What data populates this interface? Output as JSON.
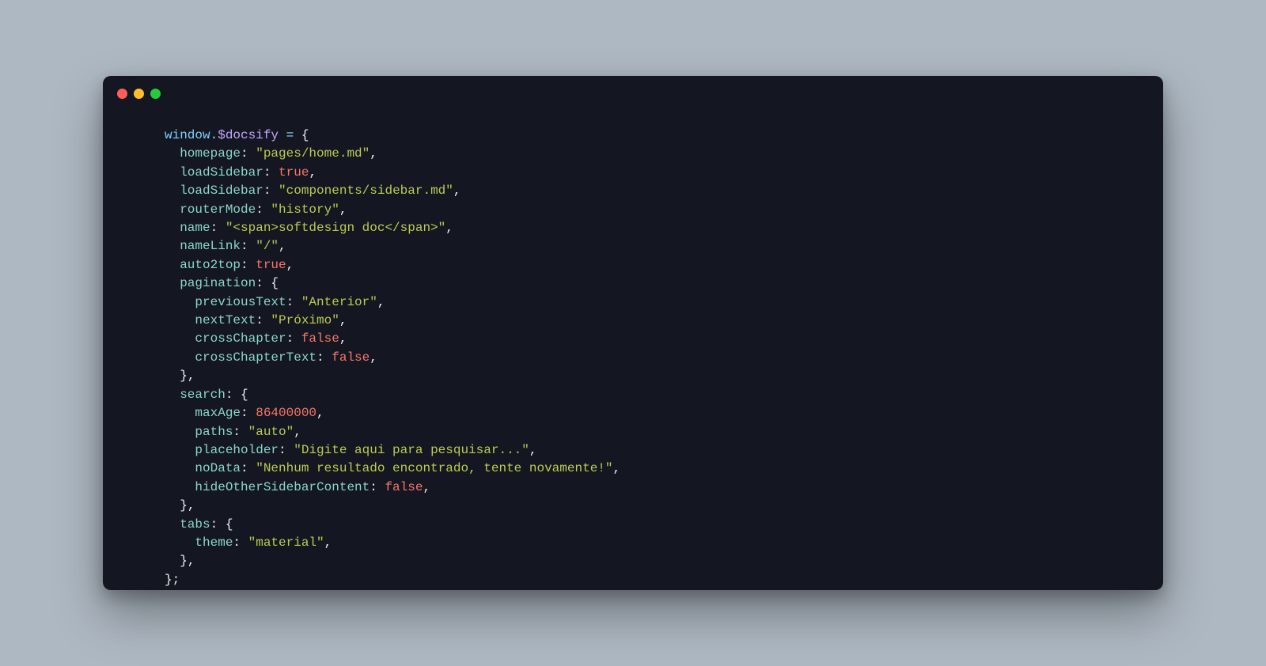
{
  "code": {
    "obj": "window",
    "dot": ".",
    "var": "$docsify",
    "eq": " = ",
    "open": "{",
    "close": "};",
    "braceClose": "}",
    "comma": ",",
    "colon": ": ",
    "colonTight": ":",
    "keys": {
      "homepage": "homepage",
      "loadSidebar": "loadSidebar",
      "routerMode": "routerMode",
      "name": "name",
      "nameLink": "nameLink",
      "auto2top": "auto2top",
      "pagination": "pagination",
      "previousText": "previousText",
      "nextText": "nextText",
      "crossChapter": "crossChapter",
      "crossChapterText": "crossChapterText",
      "search": "search",
      "maxAge": "maxAge",
      "paths": "paths",
      "placeholder": "placeholder",
      "noData": "noData",
      "hideOtherSidebarContent": "hideOtherSidebarContent",
      "tabs": "tabs",
      "theme": "theme"
    },
    "strings": {
      "homepage": "\"pages/home.md\"",
      "loadSidebar": "\"components/sidebar.md\"",
      "routerMode": "\"history\"",
      "name": "\"<span>softdesign doc</span>\"",
      "nameLink": "\"/\"",
      "previousText": "\"Anterior\"",
      "nextText": "\"Próximo\"",
      "paths": "\"auto\"",
      "placeholder": "\"Digite aqui para pesquisar...\"",
      "noData": "\"Nenhum resultado encontrado, tente novamente!\"",
      "theme": "\"material\""
    },
    "bools": {
      "true": "true",
      "false": "false"
    },
    "nums": {
      "maxAge": "86400000"
    }
  }
}
